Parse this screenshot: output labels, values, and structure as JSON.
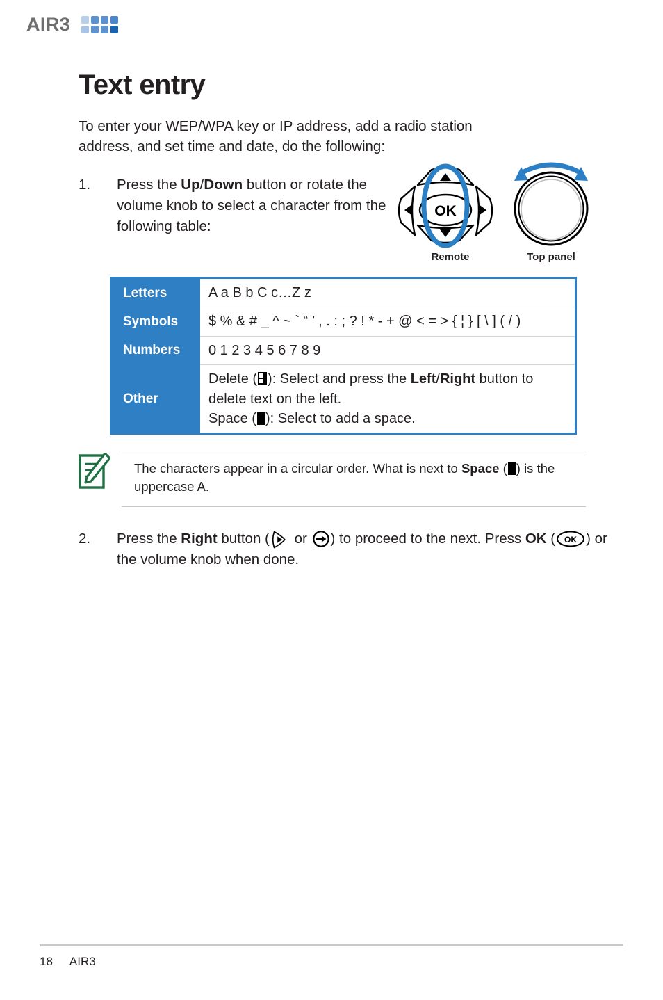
{
  "header": {
    "brand": "AIR3",
    "logo_icon": "grid-squares-icon",
    "logo_colors": [
      "#b9cfe8",
      "#5c91cd",
      "#5c91cd",
      "#4a86c8",
      "#a8c4e4",
      "#5f93ce",
      "#5f93ce",
      "#1a63b0"
    ]
  },
  "page": {
    "title": "Text entry",
    "intro": "To enter your WEP/WPA key or IP address, add a radio station address, and set time and date, do the following:"
  },
  "steps": [
    {
      "number": "1.",
      "text_part1": "Press the ",
      "bold1": "Up",
      "sep1": "/",
      "bold2": "Down",
      "text_part2": " button or rotate the volume knob to select a character from the following table:"
    },
    {
      "number": "2.",
      "text_part1": "Press the ",
      "bold1": "Right",
      "text_part2": " button (",
      "text_part3": " or ",
      "text_part4": ") to proceed to the next. Press ",
      "bold2": "OK",
      "text_part5": " (",
      "text_part6": ") or the volume knob when done."
    }
  ],
  "devices": {
    "remote_label": "Remote",
    "top_panel_label": "Top panel",
    "ok_text": "OK",
    "remote_icon": "dpad-remote-icon",
    "knob_icon": "rotary-knob-icon",
    "highlight_color": "#2b7fc4"
  },
  "table": {
    "accent_color": "#2f7fc4",
    "rows": [
      {
        "label": "Letters",
        "value": "A a B b C c…Z z"
      },
      {
        "label": "Symbols",
        "value": "$ % & # _ ^ ~ ` “ ’ , . : ; ? ! * - + @ < = > { ¦ } [ \\ ] ( / )"
      },
      {
        "label": "Numbers",
        "value": "0 1 2 3 4 5 6 7 8 9"
      }
    ],
    "other": {
      "label": "Other",
      "line1_a": "Delete (",
      "line1_b": "): Select and press the ",
      "line1_bold1": "Left",
      "line1_sep": "/",
      "line1_bold2": "Right",
      "line1_c": " button to delete text on the left.",
      "line2_a": "Space (",
      "line2_b": "): Select to add a space.",
      "delete_icon": "delete-block-icon",
      "space_icon": "space-block-icon"
    }
  },
  "note": {
    "icon": "note-pencil-icon",
    "icon_color": "#1d7041",
    "text_a": "The characters appear in a circular order. What is next to ",
    "bold": "Space",
    "text_b": " (",
    "text_c": ") is the uppercase A."
  },
  "footer": {
    "page_number": "18",
    "document_name": "AIR3"
  }
}
